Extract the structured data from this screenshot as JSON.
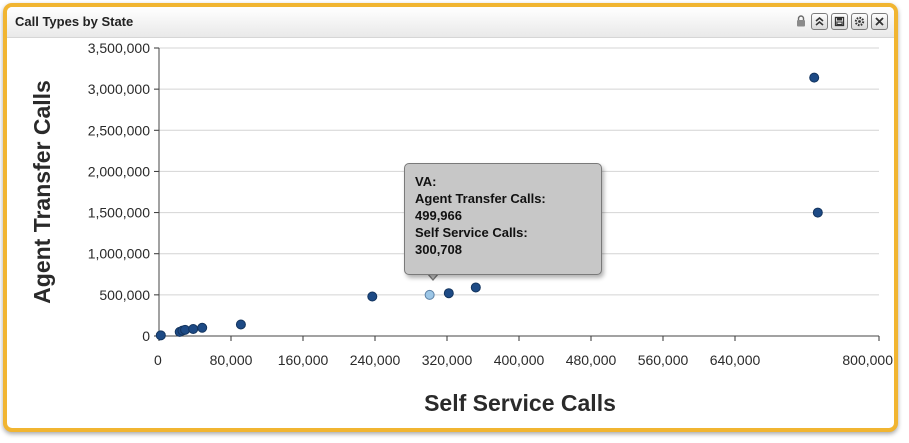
{
  "panel": {
    "title": "Call Types by State",
    "controls": [
      {
        "name": "lock-icon"
      },
      {
        "name": "collapse-icon"
      },
      {
        "name": "save-icon"
      },
      {
        "name": "settings-icon"
      },
      {
        "name": "close-icon"
      }
    ]
  },
  "tooltip": {
    "state": "VA:",
    "y_label": "Agent Transfer Calls:",
    "y_value": "499,966",
    "x_label": "Self Service Calls:",
    "x_value": "300,708"
  },
  "colors": {
    "frame": "#f1b531",
    "point": "#1d4a85",
    "point_highlight": "#9cc6e6",
    "grid": "#d4d4d4"
  },
  "chart_data": {
    "type": "scatter",
    "xlabel": "Self Service Calls",
    "ylabel": "Agent Transfer Calls",
    "xlim": [
      0,
      800000
    ],
    "ylim": [
      0,
      3500000
    ],
    "x_ticks": [
      {
        "value": 0,
        "label": "0"
      },
      {
        "value": 80000,
        "label": "80,000"
      },
      {
        "value": 160000,
        "label": "160,000"
      },
      {
        "value": 240000,
        "label": "240,000"
      },
      {
        "value": 320000,
        "label": "320,000"
      },
      {
        "value": 400000,
        "label": "400,000"
      },
      {
        "value": 480000,
        "label": "480,000"
      },
      {
        "value": 560000,
        "label": "560,000"
      },
      {
        "value": 640000,
        "label": "640,000"
      },
      {
        "value": 800000,
        "label": "800,000"
      }
    ],
    "y_ticks": [
      {
        "value": 0,
        "label": "0"
      },
      {
        "value": 500000,
        "label": "500,000"
      },
      {
        "value": 1000000,
        "label": "1,000,000"
      },
      {
        "value": 1500000,
        "label": "1,500,000"
      },
      {
        "value": 2000000,
        "label": "2,000,000"
      },
      {
        "value": 2500000,
        "label": "2,500,000"
      },
      {
        "value": 3000000,
        "label": "3,000,000"
      },
      {
        "value": 3500000,
        "label": "3,500,000"
      }
    ],
    "grid": true,
    "series": [
      {
        "points": [
          {
            "x": 2000,
            "y": 8000
          },
          {
            "x": 23000,
            "y": 50000
          },
          {
            "x": 26000,
            "y": 65000
          },
          {
            "x": 29000,
            "y": 75000
          },
          {
            "x": 38000,
            "y": 85000
          },
          {
            "x": 48000,
            "y": 100000
          },
          {
            "x": 91000,
            "y": 140000
          },
          {
            "x": 237000,
            "y": 480000
          },
          {
            "x": 300708,
            "y": 499966,
            "highlighted": true
          },
          {
            "x": 322000,
            "y": 520000
          },
          {
            "x": 352000,
            "y": 590000
          },
          {
            "x": 728000,
            "y": 3140000
          },
          {
            "x": 732000,
            "y": 1500000
          }
        ]
      }
    ]
  }
}
